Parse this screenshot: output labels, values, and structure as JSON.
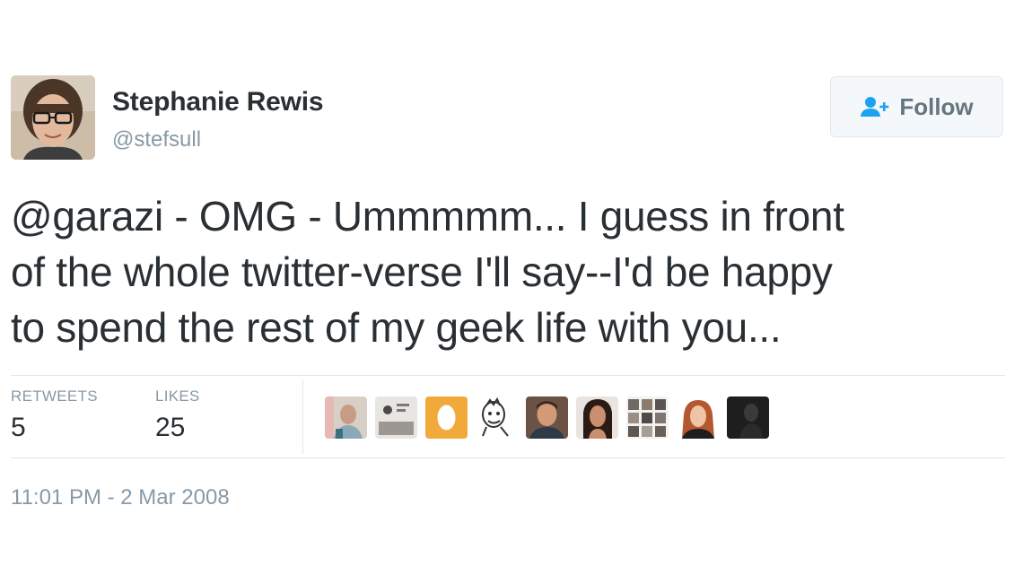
{
  "author": {
    "name": "Stephanie Rewis",
    "handle": "@stefsull",
    "avatar_icon": "user-photo"
  },
  "follow_button": {
    "label": "Follow",
    "icon": "follow-user-icon",
    "icon_color": "#1da1f2"
  },
  "tweet": {
    "lines": [
      "@garazi - OMG - Ummmmm... I guess in front",
      "of the whole twitter-verse I'll say--I'd be happy",
      "to spend the rest of my geek life with you..."
    ]
  },
  "stats": {
    "retweets_label": "RETWEETS",
    "retweets_value": "5",
    "likes_label": "LIKES",
    "likes_value": "25"
  },
  "likers": [
    {
      "icon": "liker-avatar",
      "color": "#c7b8a8"
    },
    {
      "icon": "liker-avatar",
      "color": "#b5b0a8"
    },
    {
      "icon": "liker-avatar",
      "color": "#f2a93b"
    },
    {
      "icon": "liker-avatar",
      "color": "#ffffff"
    },
    {
      "icon": "liker-avatar",
      "color": "#7a5a4a"
    },
    {
      "icon": "liker-avatar",
      "color": "#3a2a22"
    },
    {
      "icon": "liker-avatar",
      "color": "#6f6a66"
    },
    {
      "icon": "liker-avatar",
      "color": "#b8643a"
    },
    {
      "icon": "liker-avatar",
      "color": "#1e1e1e"
    }
  ],
  "timestamp": "11:01 PM - 2 Mar 2008",
  "colors": {
    "text": "#292f33",
    "secondary": "#8899a6",
    "border": "#e1e8ed"
  }
}
